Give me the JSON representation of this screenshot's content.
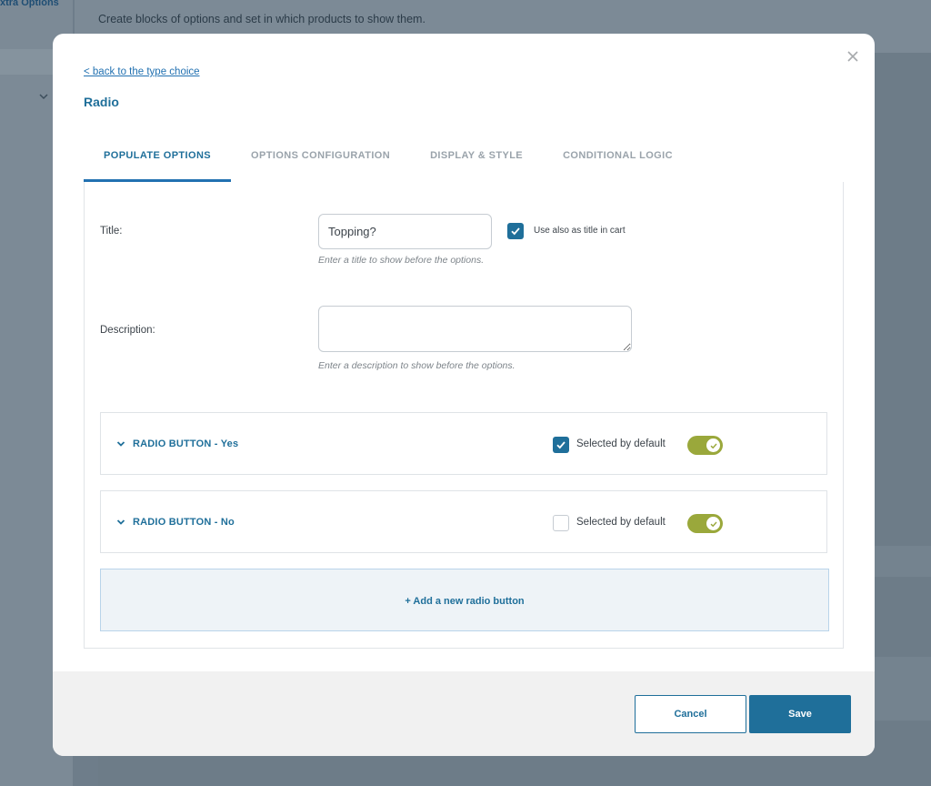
{
  "background": {
    "sidebar_title": "xtra Options",
    "description": "Create blocks of options and set in which products to show them."
  },
  "modal": {
    "back_link": "< back to the type choice",
    "title": "Radio",
    "tabs": [
      {
        "label": "POPULATE OPTIONS",
        "active": true
      },
      {
        "label": "OPTIONS CONFIGURATION",
        "active": false
      },
      {
        "label": "DISPLAY & STYLE",
        "active": false
      },
      {
        "label": "CONDITIONAL LOGIC",
        "active": false
      }
    ],
    "title_field": {
      "label": "Title:",
      "value": "Topping?",
      "help": "Enter a title to show before the options.",
      "use_in_cart_label": "Use also as title in cart",
      "use_in_cart_checked": true
    },
    "description_field": {
      "label": "Description:",
      "value": "",
      "help": "Enter a description to show before the options."
    },
    "options": [
      {
        "title": "RADIO BUTTON - Yes",
        "default_label": "Selected by default",
        "selected_by_default": true,
        "enabled": true
      },
      {
        "title": "RADIO BUTTON - No",
        "default_label": "Selected by default",
        "selected_by_default": false,
        "enabled": true
      }
    ],
    "add_button_label": "+ Add a new radio button",
    "footer": {
      "cancel_label": "Cancel",
      "save_label": "Save"
    }
  },
  "colors": {
    "accent": "#1f6f9a",
    "toggle_on": "#9aa83b",
    "overlay": "#6e7d8a"
  },
  "icons": [
    "close-icon",
    "chevron-down-icon",
    "check-icon"
  ]
}
